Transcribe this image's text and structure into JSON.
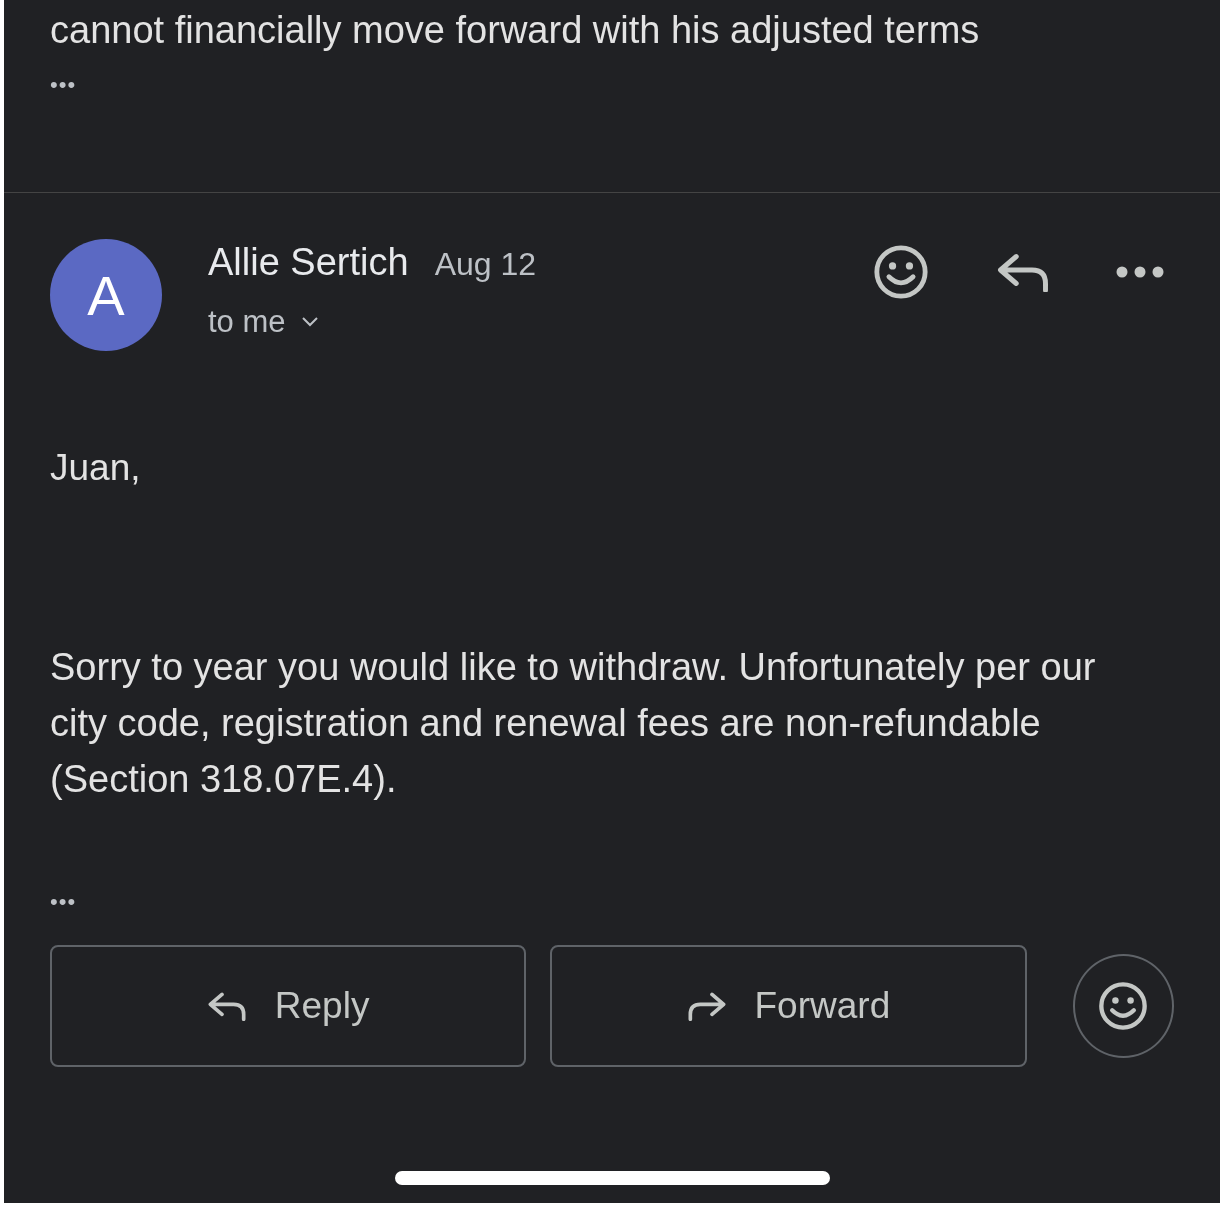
{
  "previous_message": {
    "text": "cannot financially move forward with his adjusted terms",
    "more": "•••"
  },
  "message": {
    "avatar_letter": "A",
    "sender": "Allie Sertich",
    "date": "Aug 12",
    "recipient": "to me",
    "greeting": "Juan,",
    "body": "Sorry to year you would like to withdraw. Unfortunately per our city code, registration and renewal fees are non-refundable (Section 318.07E.4).",
    "more": "•••"
  },
  "actions": [
    {
      "kind": "reply",
      "label": "Reply"
    },
    {
      "kind": "forward",
      "label": "Forward"
    }
  ]
}
